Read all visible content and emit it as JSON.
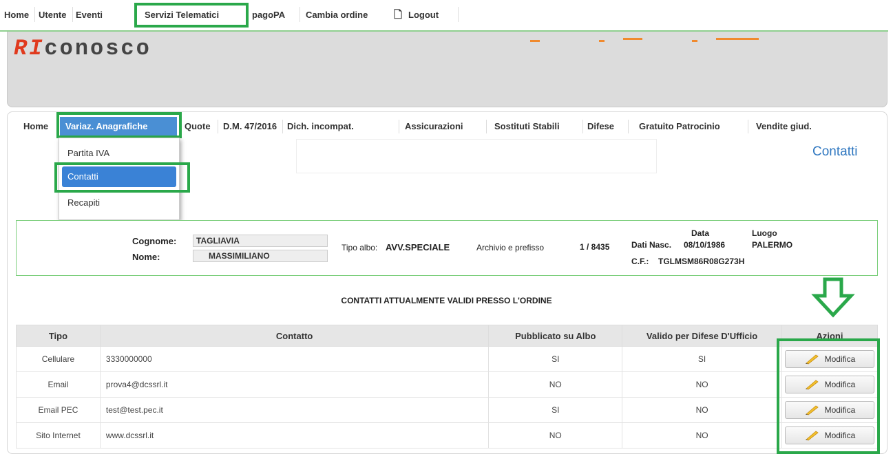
{
  "topnav": {
    "items": [
      "Home",
      "Utente",
      "Eventi",
      "Servizi Telematici",
      "pagoPA",
      "Cambia ordine",
      "Logout"
    ]
  },
  "logo": {
    "prefix": "RI",
    "rest": "conosco"
  },
  "subnav": {
    "items": [
      "Home",
      "Variaz. Anagrafiche",
      "Quote",
      "D.M. 47/2016",
      "Dich. incompat.",
      "Assicurazioni",
      "Sostituti Stabili",
      "Difese",
      "Gratuito Patrocinio",
      "Vendite giud."
    ]
  },
  "dropdown": {
    "options": [
      "Partita IVA",
      "Contatti",
      "Recapiti"
    ],
    "selected": "Contatti"
  },
  "page_title": "Contatti",
  "person": {
    "cognome_label": "Cognome:",
    "cognome": "TAGLIAVIA",
    "nome_label": "Nome:",
    "nome": "MASSIMILIANO",
    "tipo_albo_label": "Tipo albo:",
    "tipo_albo": "AVV.SPECIALE",
    "archivio_label": "Archivio e prefisso",
    "archivio": "1 / 8435",
    "data_label": "Data",
    "luogo_label": "Luogo",
    "dati_nasc_label": "Dati Nasc.",
    "data_nasc": "08/10/1986",
    "luogo_nasc": "PALERMO",
    "cf_label": "C.F.:",
    "cf": "TGLMSM86R08G273H"
  },
  "section_title": "CONTATTI ATTUALMENTE VALIDI PRESSO L'ORDINE",
  "table": {
    "headers": [
      "Tipo",
      "Contatto",
      "Pubblicato su Albo",
      "Valido per Difese D'Ufficio",
      "Azioni"
    ],
    "rows": [
      {
        "tipo": "Cellulare",
        "contatto": "3330000000",
        "pubblicato": "SI",
        "valido": "SI",
        "azione": "Modifica"
      },
      {
        "tipo": "Email",
        "contatto": "prova4@dcssrl.it",
        "pubblicato": "NO",
        "valido": "NO",
        "azione": "Modifica"
      },
      {
        "tipo": "Email PEC",
        "contatto": "test@test.pec.it",
        "pubblicato": "SI",
        "valido": "NO",
        "azione": "Modifica"
      },
      {
        "tipo": "Sito Internet",
        "contatto": "www.dcssrl.it",
        "pubblicato": "NO",
        "valido": "NO",
        "azione": "Modifica"
      }
    ]
  },
  "colors": {
    "highlight": "#2aa84a",
    "accent": "#3a82d6",
    "logo_red": "#e03a1e"
  }
}
